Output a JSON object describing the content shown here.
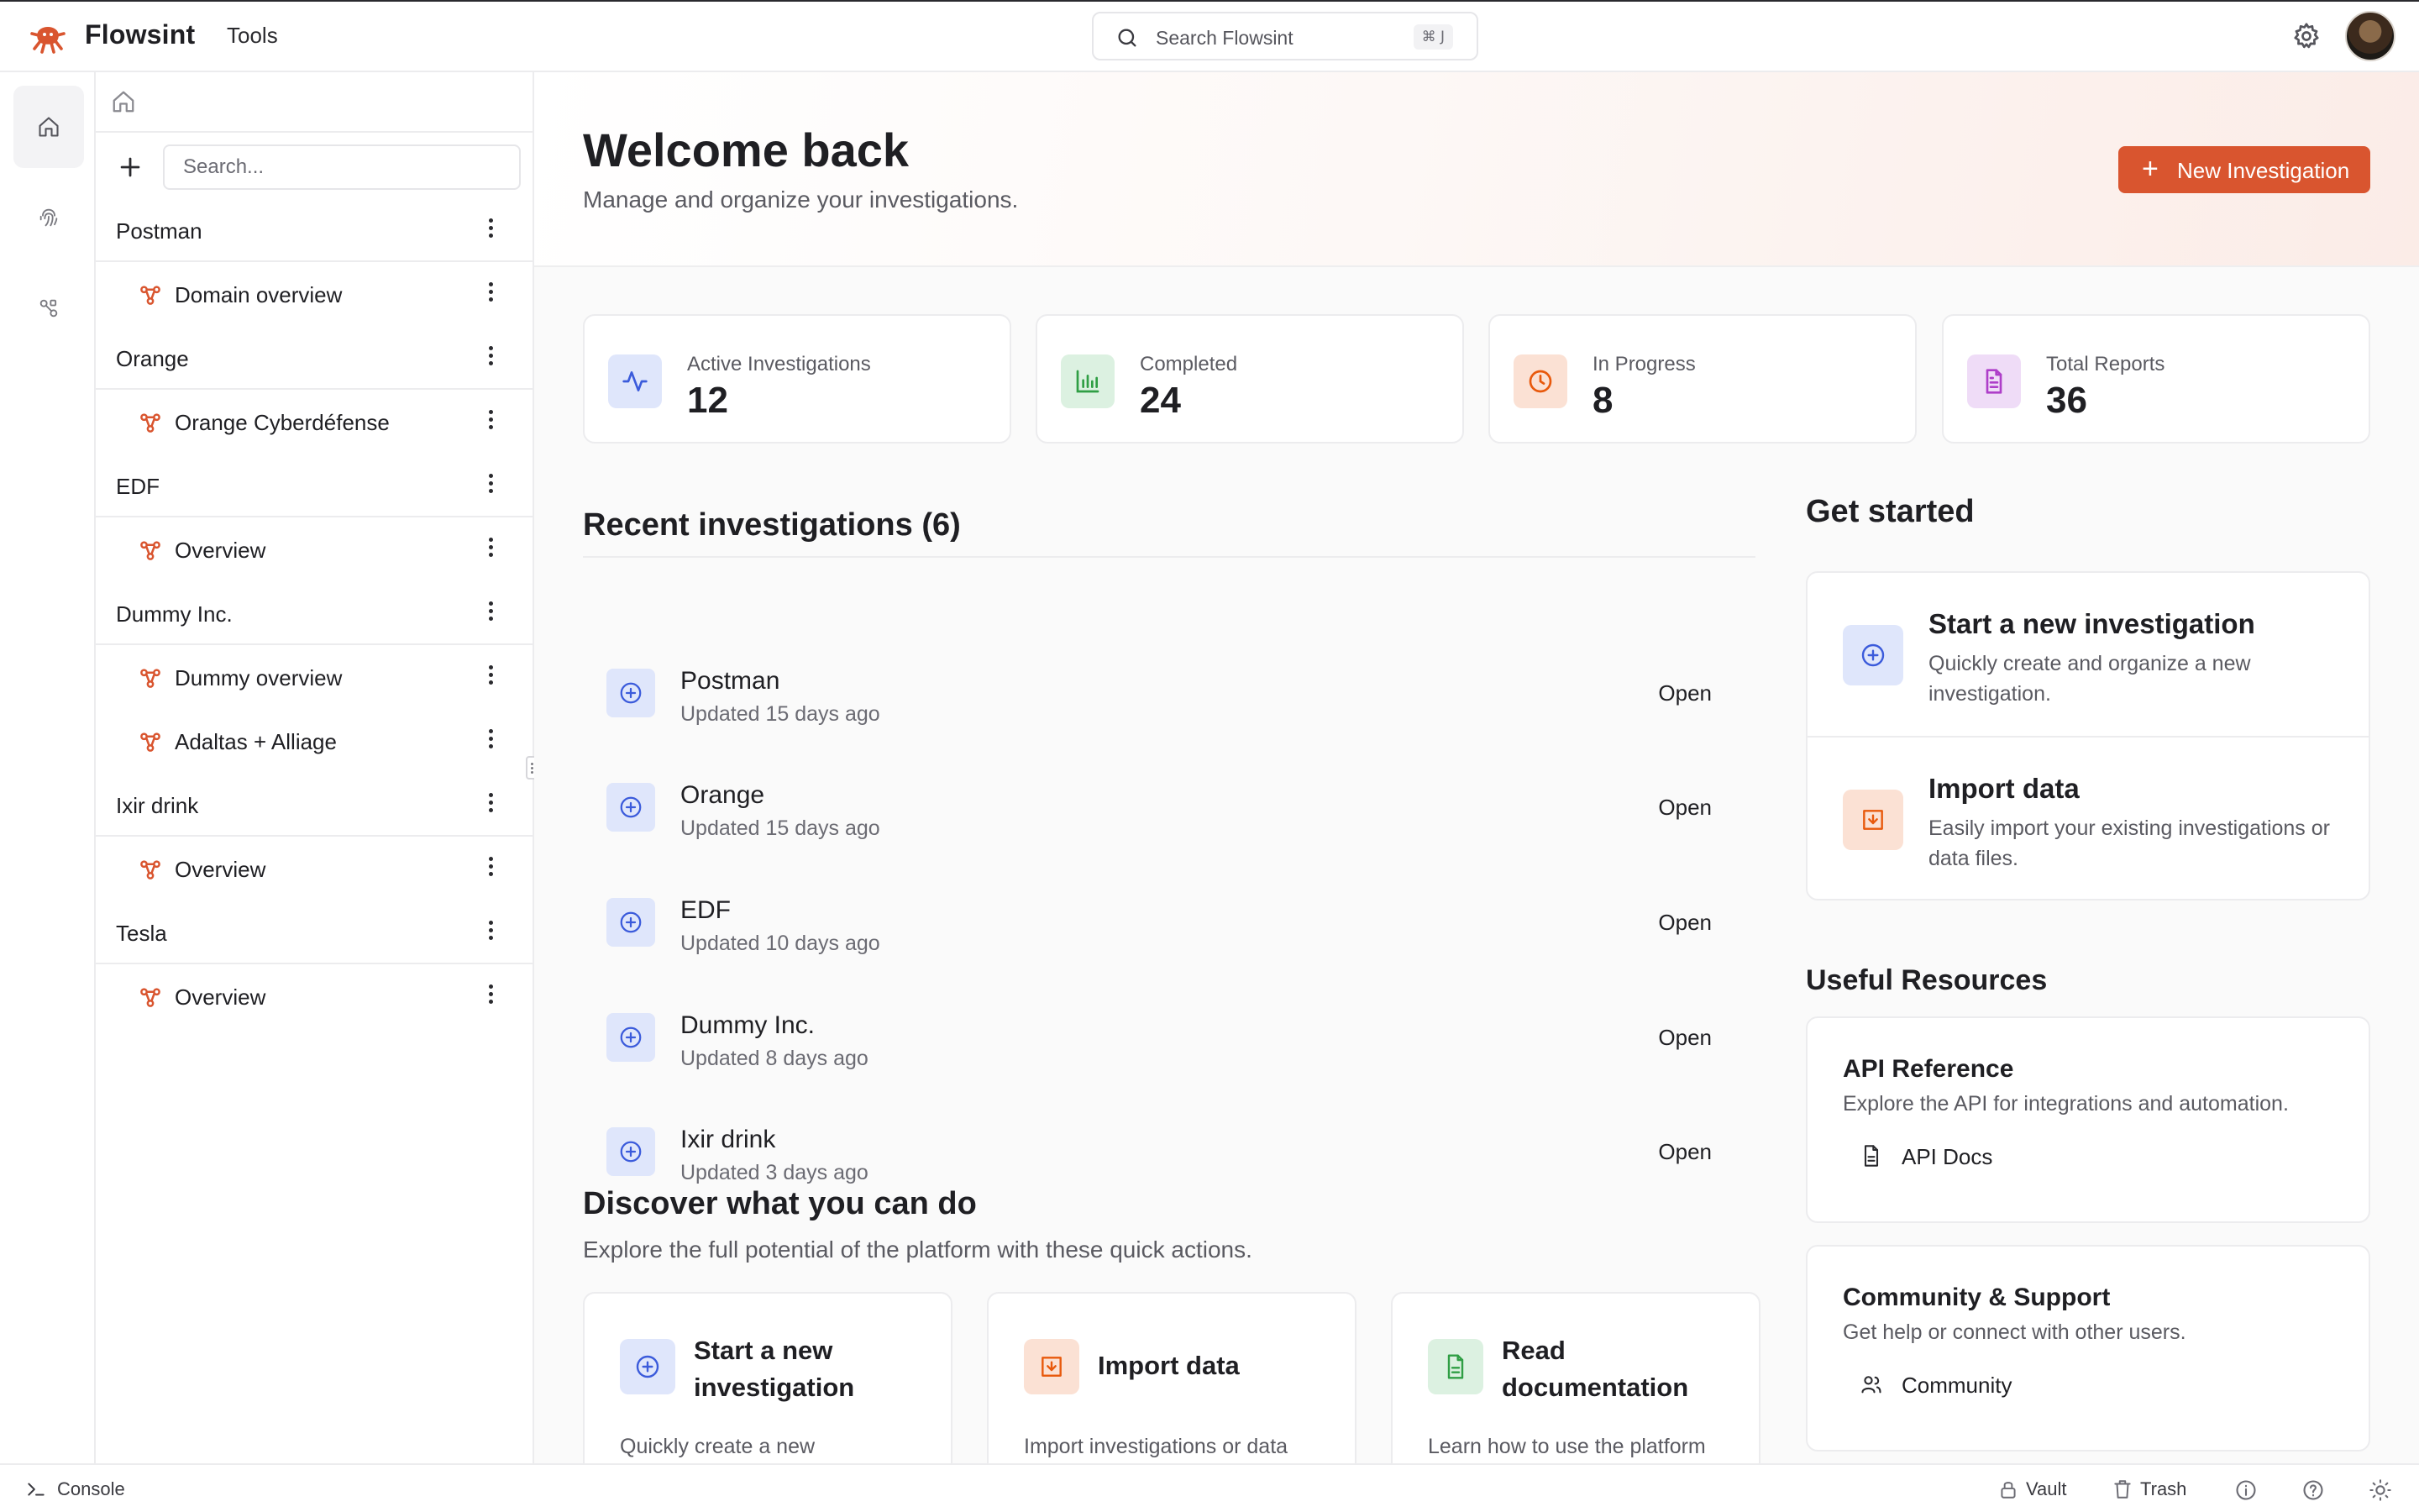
{
  "app": {
    "name": "Flowsint",
    "menu_tools": "Tools",
    "search_label": "Search Flowsint",
    "search_shortcut": "⌘ J",
    "accent": "#d9552f"
  },
  "sidebar": {
    "search_placeholder": "Search...",
    "groups": [
      {
        "label": "Postman",
        "children": [
          "Domain overview"
        ]
      },
      {
        "label": "Orange",
        "children": [
          "Orange Cyberdéfense"
        ]
      },
      {
        "label": "EDF",
        "children": [
          "Overview"
        ]
      },
      {
        "label": "Dummy Inc.",
        "children": [
          "Dummy overview",
          "Adaltas + Alliage"
        ]
      },
      {
        "label": "Ixir drink",
        "children": [
          "Overview"
        ]
      },
      {
        "label": "Tesla",
        "children": [
          "Overview"
        ]
      }
    ]
  },
  "header": {
    "title": "Welcome back",
    "subtitle": "Manage and organize your investigations.",
    "new_button": "New Investigation"
  },
  "stats": [
    {
      "label": "Active Investigations",
      "value": "12",
      "icon": "activity-icon",
      "color": "#dfe6fb"
    },
    {
      "label": "Completed",
      "value": "24",
      "icon": "bar-chart-icon",
      "color": "#dcf1e1"
    },
    {
      "label": "In Progress",
      "value": "8",
      "icon": "clock-icon",
      "color": "#fbe1d4"
    },
    {
      "label": "Total Reports",
      "value": "36",
      "icon": "file-text-icon",
      "color": "#efdcf7"
    }
  ],
  "recent": {
    "title": "Recent investigations (6)",
    "open_label": "Open",
    "items": [
      {
        "name": "Postman",
        "updated": "Updated 15 days ago"
      },
      {
        "name": "Orange",
        "updated": "Updated 15 days ago"
      },
      {
        "name": "EDF",
        "updated": "Updated 10 days ago"
      },
      {
        "name": "Dummy Inc.",
        "updated": "Updated 8 days ago"
      },
      {
        "name": "Ixir drink",
        "updated": "Updated 3 days ago"
      }
    ]
  },
  "discover": {
    "title": "Discover what you can do",
    "subtitle": "Explore the full potential of the platform with these quick actions.",
    "cards": [
      {
        "title": "Start a new investigation",
        "desc": "Quickly create a new"
      },
      {
        "title": "Import data",
        "desc": "Import investigations or data"
      },
      {
        "title": "Read documentation",
        "desc": "Learn how to use the platform"
      }
    ]
  },
  "get_started": {
    "title": "Get started",
    "items": [
      {
        "title": "Start a new investigation",
        "desc": "Quickly create and organize a new investigation."
      },
      {
        "title": "Import data",
        "desc": "Easily import your existing investigations or data files."
      }
    ]
  },
  "resources": {
    "title": "Useful Resources",
    "api": {
      "title": "API Reference",
      "desc": "Explore the API for integrations and automation.",
      "link": "API Docs"
    },
    "community": {
      "title": "Community & Support",
      "desc": "Get help or connect with other users.",
      "link": "Community"
    }
  },
  "statusbar": {
    "console": "Console",
    "vault": "Vault",
    "trash": "Trash"
  }
}
